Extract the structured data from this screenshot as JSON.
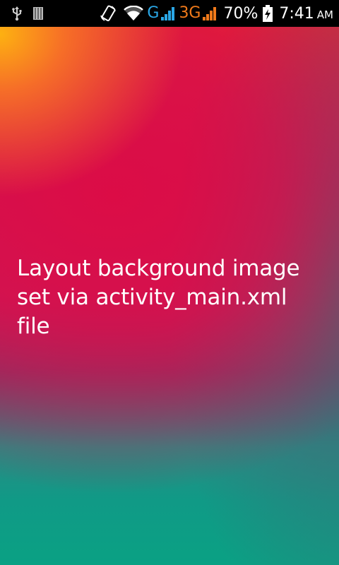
{
  "status_bar": {
    "icons_left": [
      "usb-icon",
      "sd-card-icon"
    ],
    "network_g": "G",
    "network_3g": "3G",
    "battery_percent": "70%",
    "time": "7:41",
    "ampm": "AM",
    "colors": {
      "g_color": "#2aa7e6",
      "threeg_color": "#f07a1a",
      "background": "#000000"
    }
  },
  "main": {
    "text": "Layout background image set via activity_main.xml file",
    "gradient_colors": [
      "#ffb90f",
      "#dc0c46",
      "#c81a5a",
      "#2a8a84",
      "#0aa184"
    ]
  }
}
